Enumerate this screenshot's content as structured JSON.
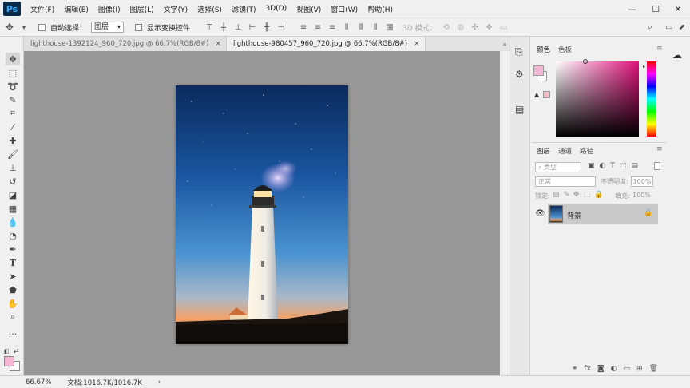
{
  "app": {
    "logo": "Ps"
  },
  "menu": [
    "文件(F)",
    "编辑(E)",
    "图像(I)",
    "图层(L)",
    "文字(Y)",
    "选择(S)",
    "滤镜(T)",
    "3D(D)",
    "视图(V)",
    "窗口(W)",
    "帮助(H)"
  ],
  "window_controls": {
    "minimize": "—",
    "maximize": "☐",
    "close": "✕"
  },
  "options": {
    "auto_select_label": "自动选择：",
    "auto_select_value": "图层",
    "show_transform_label": "显示变换控件",
    "mode_3d_label": "3D 模式："
  },
  "tabs": [
    {
      "label": "lighthouse-1392124_960_720.jpg @ 66.7%(RGB/8#)",
      "close": "×"
    },
    {
      "label": "lighthouse-980457_960_720.jpg @ 66.7%(RGB/8#)",
      "close": "×"
    }
  ],
  "color_panel": {
    "tabs": [
      "颜色",
      "色板"
    ],
    "foreground": "#f4b8d4",
    "background": "#ffffff",
    "hue": "#e0107a"
  },
  "layers_panel": {
    "tabs": [
      "图层",
      "通道",
      "路径"
    ],
    "search_placeholder": "类型",
    "blend_mode": "正常",
    "opacity_label": "不透明度:",
    "opacity_value": "100%",
    "lock_label": "锁定:",
    "fill_label": "填充:",
    "fill_value": "100%",
    "layers": [
      {
        "name": "背景"
      }
    ]
  },
  "status": {
    "zoom": "66.67%",
    "doc_info": "文档:1016.7K/1016.7K",
    "arrow": "›"
  },
  "colors": {
    "sky_top": "#0b2a5c",
    "sky_mid": "#2f7fc0",
    "horizon": "#f2a36a",
    "panel_bg": "#f0f0f0",
    "canvas_bg": "#989898"
  }
}
